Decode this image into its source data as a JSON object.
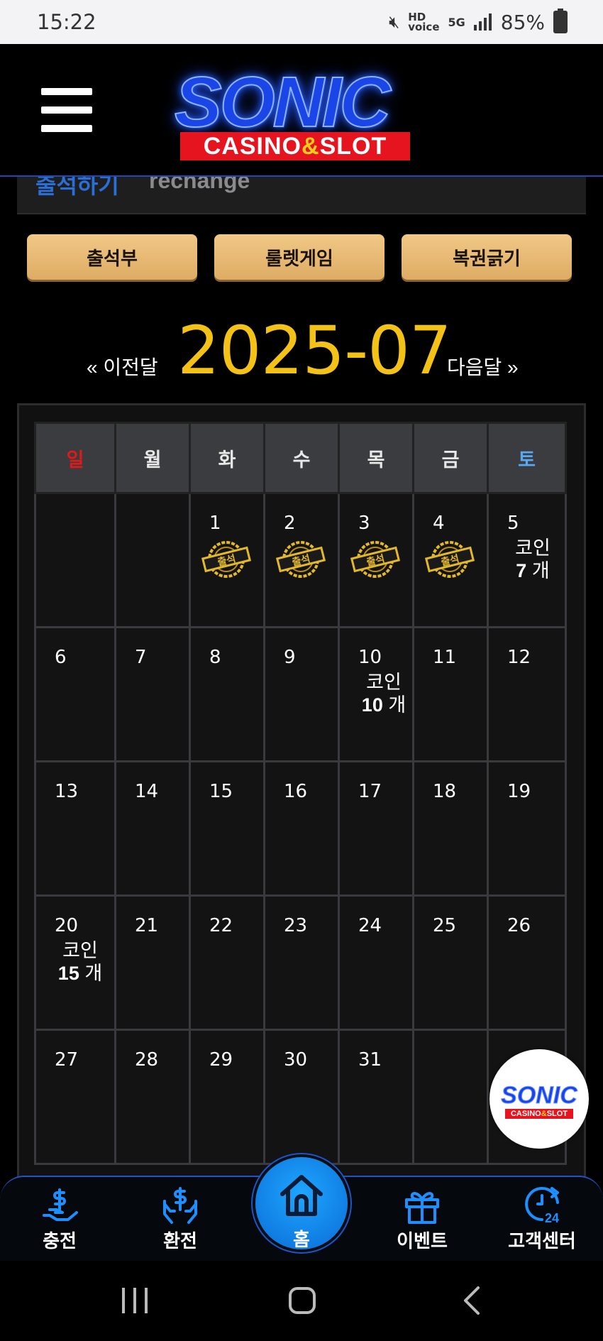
{
  "status_bar": {
    "time": "15:22",
    "battery": "85%"
  },
  "header": {
    "logo_main": "SONIC",
    "logo_sub_a": "CASINO",
    "logo_sub_amp": "&",
    "logo_sub_b": "SLOT"
  },
  "strip": {
    "title": "출석하기",
    "subtitle": "rechange"
  },
  "tabs": [
    {
      "label": "출석부"
    },
    {
      "label": "룰렛게임"
    },
    {
      "label": "복권긁기"
    }
  ],
  "month_nav": {
    "prev": "« 이전달",
    "current": "2025-07",
    "next": "다음달 »"
  },
  "calendar": {
    "weekdays": [
      "일",
      "월",
      "화",
      "수",
      "목",
      "금",
      "토"
    ],
    "weekday_colors": {
      "sunday": "#e01919",
      "saturday": "#5aa8f0",
      "default": "#e8e8e8"
    },
    "stamp_text": "출석",
    "coin_label": "코인",
    "coin_unit": "개",
    "weeks": [
      [
        {
          "day": ""
        },
        {
          "day": ""
        },
        {
          "day": "1",
          "stamp": true
        },
        {
          "day": "2",
          "stamp": true
        },
        {
          "day": "3",
          "stamp": true
        },
        {
          "day": "4",
          "stamp": true
        },
        {
          "day": "5",
          "coin": "7"
        }
      ],
      [
        {
          "day": "6"
        },
        {
          "day": "7"
        },
        {
          "day": "8"
        },
        {
          "day": "9"
        },
        {
          "day": "10",
          "coin": "10"
        },
        {
          "day": "11"
        },
        {
          "day": "12"
        }
      ],
      [
        {
          "day": "13"
        },
        {
          "day": "14"
        },
        {
          "day": "15"
        },
        {
          "day": "16"
        },
        {
          "day": "17"
        },
        {
          "day": "18"
        },
        {
          "day": "19"
        }
      ],
      [
        {
          "day": "20",
          "coin": "15"
        },
        {
          "day": "21"
        },
        {
          "day": "22"
        },
        {
          "day": "23"
        },
        {
          "day": "24"
        },
        {
          "day": "25"
        },
        {
          "day": "26"
        }
      ],
      [
        {
          "day": "27"
        },
        {
          "day": "28"
        },
        {
          "day": "29"
        },
        {
          "day": "30"
        },
        {
          "day": "31"
        },
        {
          "day": ""
        },
        {
          "day": ""
        }
      ]
    ]
  },
  "bottom_nav": {
    "charge": "충전",
    "exchange": "환전",
    "home": "홈",
    "event": "이벤트",
    "support": "고객센터"
  },
  "colors": {
    "accent_gold": "#f4c116",
    "button_gold": "#e3b36c",
    "nav_blue": "#1e8fff"
  }
}
